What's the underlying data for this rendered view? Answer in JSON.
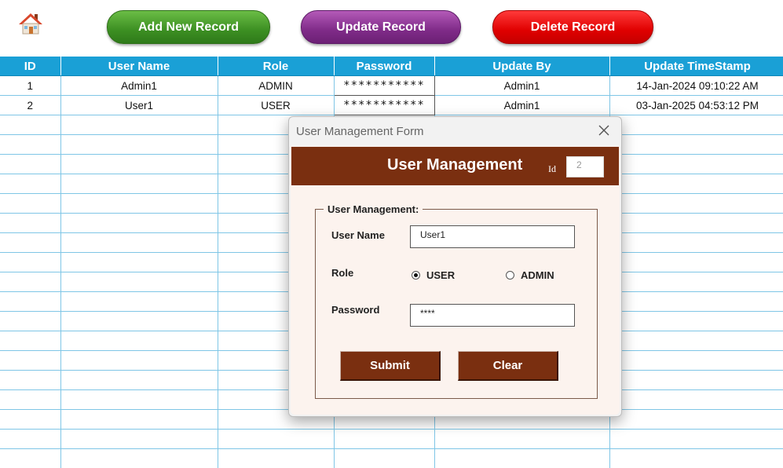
{
  "toolbar": {
    "add_label": "Add New Record",
    "update_label": "Update Record",
    "delete_label": "Delete Record",
    "home_icon": "home-icon",
    "colors": {
      "add": "#3c8f22",
      "update": "#7f2b88",
      "delete": "#e00000"
    }
  },
  "table": {
    "header_color": "#1aa0d6",
    "columns": [
      "ID",
      "User Name",
      "Role",
      "Password",
      "Update By",
      "Update TimeStamp"
    ],
    "rows": [
      [
        "1",
        "Admin1",
        "ADMIN",
        "***********",
        "Admin1",
        "14-Jan-2024 09:10:22 AM"
      ],
      [
        "2",
        "User1",
        "USER",
        "***********",
        "Admin1",
        "03-Jan-2025 04:53:12 PM"
      ]
    ]
  },
  "dialog": {
    "title": "User Management Form",
    "heading": "User Management",
    "id_label": "Id",
    "id_value": "2",
    "header_color": "#7a2f10",
    "frame_label": "User Management:",
    "username_label": "User Name",
    "username_value": "User1",
    "role_label": "Role",
    "role_options": [
      "USER",
      "ADMIN"
    ],
    "role_selected": "USER",
    "password_label": "Password",
    "password_value": "****",
    "submit_label": "Submit",
    "clear_label": "Clear"
  }
}
